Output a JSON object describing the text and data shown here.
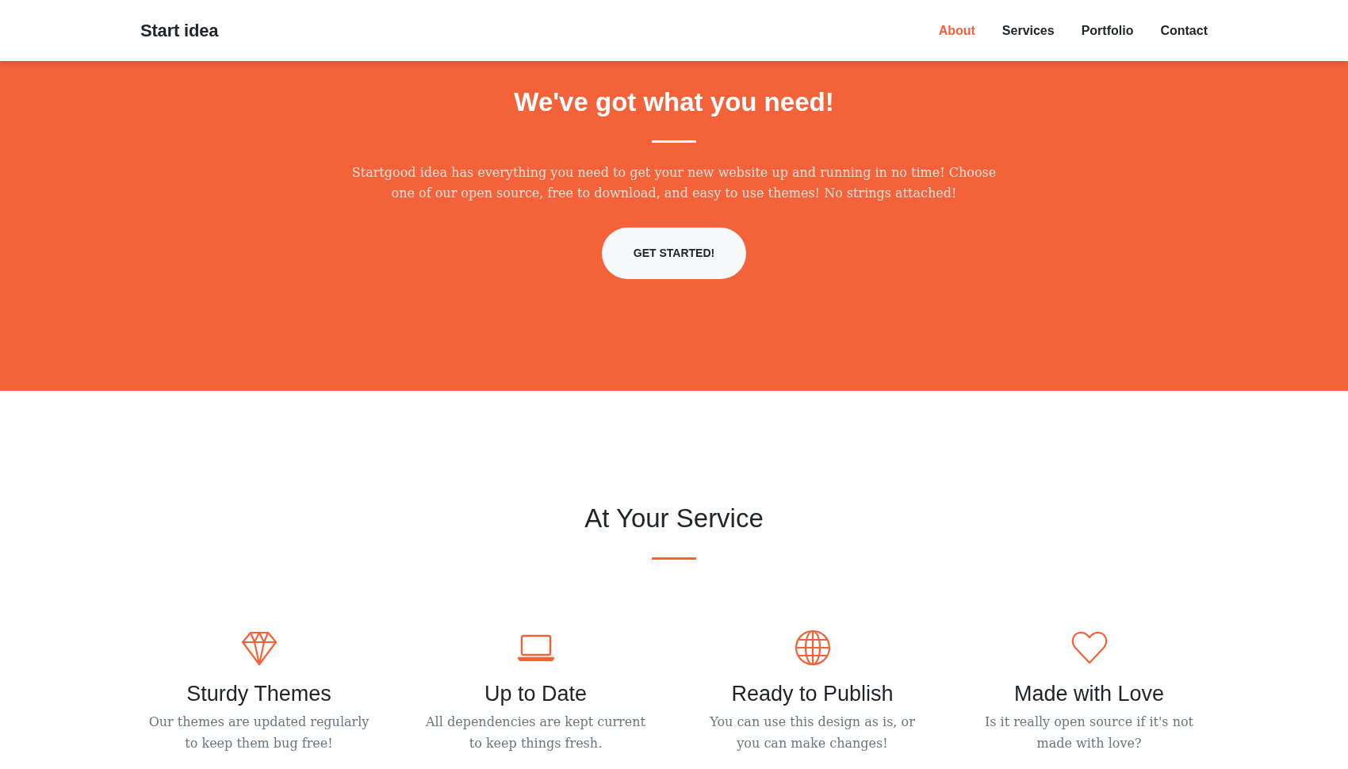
{
  "navbar": {
    "brand": "Start idea",
    "links": [
      {
        "label": "About",
        "selected": true
      },
      {
        "label": "Services",
        "selected": false
      },
      {
        "label": "Portfolio",
        "selected": false
      },
      {
        "label": "Contact",
        "selected": false
      }
    ]
  },
  "hero": {
    "title": "We've got what you need!",
    "text": "Startgood idea has everything you need to get your new website up and running in no time! Choose one of our open source, free to download, and easy to use themes! No strings attached!",
    "button": "GET STARTED!"
  },
  "services": {
    "title": "At Your Service",
    "items": [
      {
        "title": "Sturdy Themes",
        "text": "Our themes are updated regularly to keep them bug free!"
      },
      {
        "title": "Up to Date",
        "text": "All dependencies are kept current to keep things fresh."
      },
      {
        "title": "Ready to Publish",
        "text": "You can use this design as is, or you can make changes!"
      },
      {
        "title": "Made with Love",
        "text": "Is it really open source if it's not made with love?"
      }
    ]
  }
}
